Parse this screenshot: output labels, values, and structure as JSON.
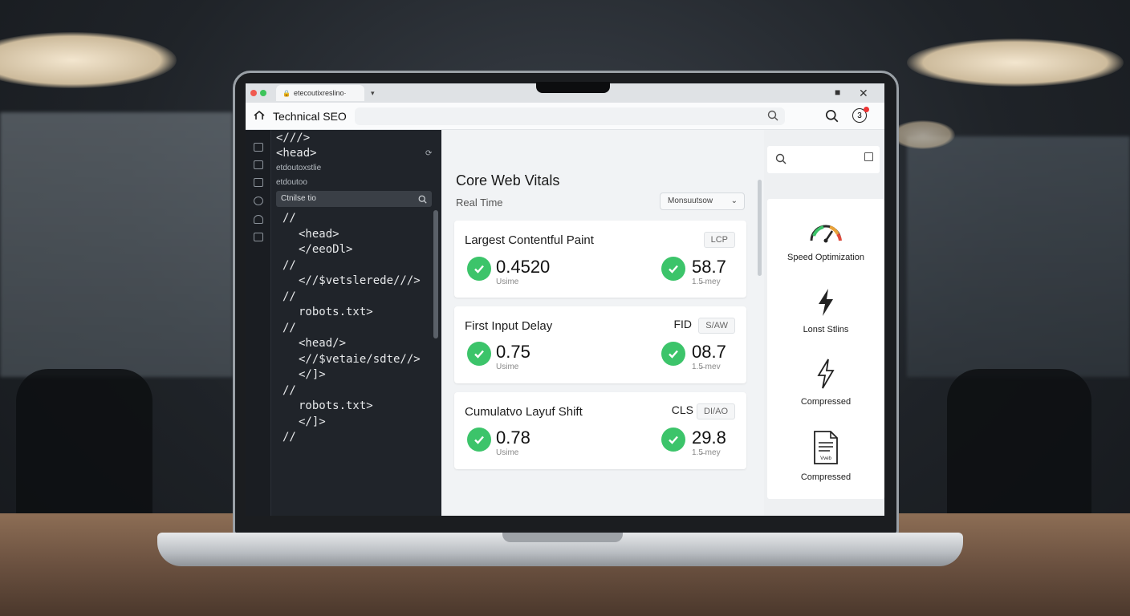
{
  "browser": {
    "tab_title": "etecoutixreslino·",
    "app_title": "Technical SEO"
  },
  "code": {
    "top_lines": [
      "<///>",
      "<head>"
    ],
    "small_lines": [
      "etdoutoxstlie",
      "etdoutoo"
    ],
    "search_label": "Ctnilse tio",
    "lines": [
      {
        "text": "//",
        "indent": 0
      },
      {
        "text": "<head>",
        "indent": 2
      },
      {
        "text": "</eeoDl>",
        "indent": 2
      },
      {
        "text": "//",
        "indent": 0
      },
      {
        "text": "<//$vetslerede///>",
        "indent": 2
      },
      {
        "text": "//",
        "indent": 0
      },
      {
        "text": "robots.txt>",
        "indent": 2
      },
      {
        "text": "//",
        "indent": 0
      },
      {
        "text": "<head/>",
        "indent": 2
      },
      {
        "text": "<//$vetaie/sdte//>",
        "indent": 2
      },
      {
        "text": "</]>",
        "indent": 2
      },
      {
        "text": "//",
        "indent": 0
      },
      {
        "text": "robots.txt>",
        "indent": 2
      },
      {
        "text": "</]>",
        "indent": 2
      },
      {
        "text": "//",
        "indent": 0
      }
    ]
  },
  "vitals": {
    "title": "Core Web Vitals",
    "subtitle": "Real Time",
    "select_value": "Monsuutsow",
    "cards": [
      {
        "name": "Largest Contentful Paint",
        "abbr": "",
        "pill": "LCP",
        "v1": "0.4520",
        "u1": "Usime",
        "v2": "58.7",
        "u2": "1.5̶ mey"
      },
      {
        "name": "First Input Delay",
        "abbr": "FID",
        "pill": "S/AW",
        "v1": "0.75",
        "u1": "Usime",
        "v2": "08.7",
        "u2": "1.5̶ mev"
      },
      {
        "name": "Cumulatvo Layuf Shift",
        "abbr": "CLS",
        "pill": "DI/AO",
        "v1": "0.78",
        "u1": "Usime",
        "v2": "29.8",
        "u2": "1.5̶ mey"
      }
    ]
  },
  "sidebar_right": {
    "items": [
      {
        "label": "Speed Optimization",
        "icon": "gauge-icon"
      },
      {
        "label": "Lonst Stlins",
        "icon": "lightning-icon"
      },
      {
        "label": "Compressed",
        "icon": "lightning-outline-icon"
      },
      {
        "label": "Compressed",
        "icon": "document-icon",
        "doc_text": "Vveb"
      }
    ]
  },
  "colors": {
    "accent_green": "#3cc46a",
    "code_bg": "#20242a"
  }
}
